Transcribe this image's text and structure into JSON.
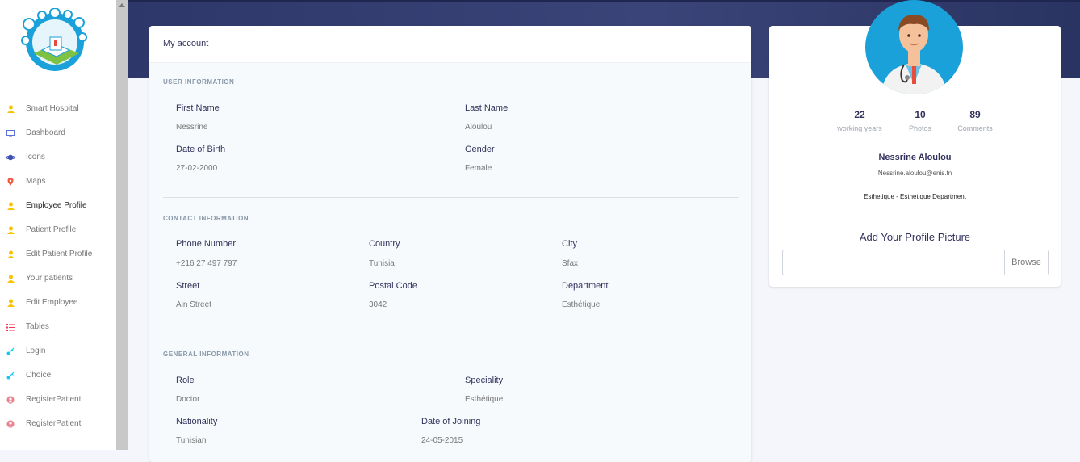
{
  "sidebar": {
    "items": [
      {
        "label": "Smart Hospital",
        "icon": "person-icon",
        "color": "#f7c200"
      },
      {
        "label": "Dashboard",
        "icon": "monitor-icon",
        "color": "#5a6fd8"
      },
      {
        "label": "Icons",
        "icon": "planet-icon",
        "color": "#3f51b5"
      },
      {
        "label": "Maps",
        "icon": "pin-icon",
        "color": "#f5543b"
      },
      {
        "label": "Employee Profile",
        "icon": "person-icon",
        "color": "#f7c200"
      },
      {
        "label": "Patient Profile",
        "icon": "person-icon",
        "color": "#f7c200"
      },
      {
        "label": "Edit Patient Profile",
        "icon": "person-icon",
        "color": "#f7c200"
      },
      {
        "label": "Your patients",
        "icon": "person-icon",
        "color": "#f7c200"
      },
      {
        "label": "Edit Employee",
        "icon": "person-icon",
        "color": "#f7c200"
      },
      {
        "label": "Tables",
        "icon": "list-icon",
        "color": "#f5365c"
      },
      {
        "label": "Login",
        "icon": "key-icon",
        "color": "#11cdef"
      },
      {
        "label": "Choice",
        "icon": "key-icon",
        "color": "#11cdef"
      },
      {
        "label": "RegisterPatient",
        "icon": "user-circle-icon",
        "color": "#e8838f"
      },
      {
        "label": "RegisterPatient",
        "icon": "user-circle-icon",
        "color": "#e8838f"
      }
    ],
    "active_label": "Employee Profile"
  },
  "account": {
    "title": "My account",
    "user_info": {
      "section": "USER INFORMATION",
      "first_name_label": "First Name",
      "first_name": "Nessrine",
      "last_name_label": "Last Name",
      "last_name": "Aloulou",
      "dob_label": "Date of Birth",
      "dob": "27-02-2000",
      "gender_label": "Gender",
      "gender": "Female"
    },
    "contact_info": {
      "section": "CONTACT INFORMATION",
      "phone_label": "Phone Number",
      "phone": "+216 27 497 797",
      "country_label": "Country",
      "country": "Tunisia",
      "city_label": "City",
      "city": "Sfax",
      "street_label": "Street",
      "street": "Ain Street",
      "postal_label": "Postal Code",
      "postal": "3042",
      "department_label": "Department",
      "department": "Esthétique"
    },
    "general_info": {
      "section": "GENERAL INFORMATION",
      "role_label": "Role",
      "role": "Doctor",
      "speciality_label": "Speciality",
      "speciality": "Esthétique",
      "nationality_label": "Nationality",
      "nationality": "Tunisian",
      "joining_label": "Date of Joining",
      "joining": "24-05-2015"
    }
  },
  "profile": {
    "stats": [
      {
        "value": "22",
        "label": "working years"
      },
      {
        "value": "10",
        "label": "Photos"
      },
      {
        "value": "89",
        "label": "Comments"
      }
    ],
    "name": "Nessrine Aloulou",
    "email": "Nessrine.aloulou@enis.tn",
    "department": "Esthetique - Esthetique Department",
    "upload_title": "Add Your Profile Picture",
    "browse_label": "Browse"
  },
  "colors": {
    "header": "#2d3769",
    "avatar_bg": "#1aa1d9"
  }
}
